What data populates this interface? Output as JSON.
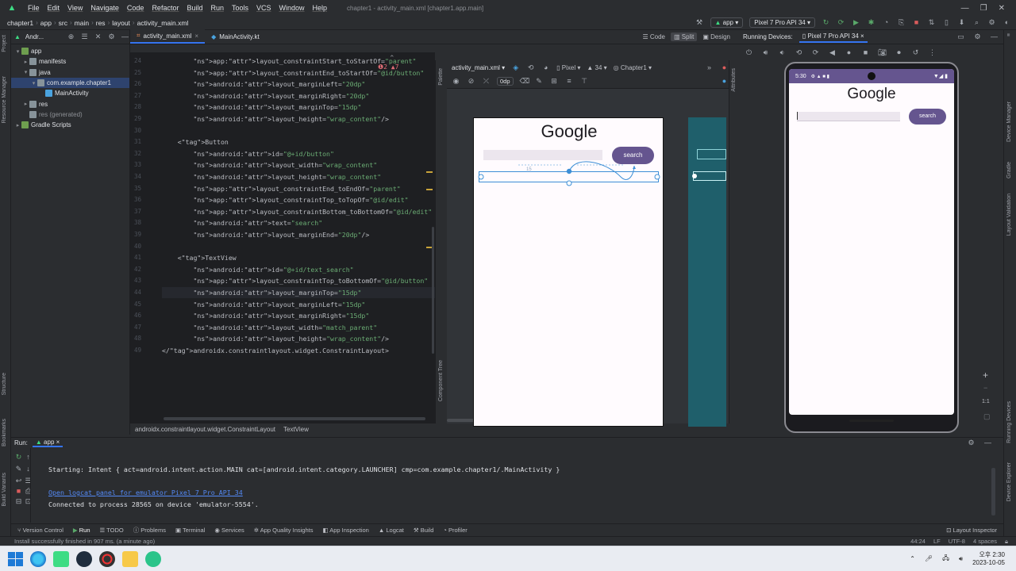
{
  "menubar": {
    "items": [
      "File",
      "Edit",
      "View",
      "Navigate",
      "Code",
      "Refactor",
      "Build",
      "Run",
      "Tools",
      "VCS",
      "Window",
      "Help"
    ],
    "title": "chapter1 - activity_main.xml [chapter1.app.main]"
  },
  "navbar": {
    "crumbs": [
      "chapter1",
      "app",
      "src",
      "main",
      "res",
      "layout",
      "activity_main.xml"
    ],
    "run_config": "app",
    "device": "Pixel 7 Pro API 34"
  },
  "project": {
    "header": "Andr...",
    "tree": [
      {
        "label": "app",
        "indent": 0,
        "arrow": "▾",
        "icon": "#6e9e4f"
      },
      {
        "label": "manifests",
        "indent": 1,
        "arrow": "▸",
        "icon": "#87939a"
      },
      {
        "label": "java",
        "indent": 1,
        "arrow": "▾",
        "icon": "#87939a"
      },
      {
        "label": "com.example.chapter1",
        "indent": 2,
        "arrow": "▾",
        "icon": "#87939a",
        "selected": true
      },
      {
        "label": "MainActivity",
        "indent": 3,
        "arrow": "",
        "icon": "#4aa3df"
      },
      {
        "label": "res",
        "indent": 1,
        "arrow": "▸",
        "icon": "#87939a"
      },
      {
        "label": "res (generated)",
        "indent": 1,
        "arrow": "",
        "icon": "#87939a",
        "dim": true
      },
      {
        "label": "Gradle Scripts",
        "indent": 0,
        "arrow": "▸",
        "icon": "#6e9e4f"
      }
    ]
  },
  "left_strip": {
    "project": "Project",
    "resource_manager": "Resource Manager",
    "structure": "Structure",
    "bookmarks": "Bookmarks",
    "build_variants": "Build Variants"
  },
  "editor": {
    "tabs": [
      {
        "label": "activity_main.xml",
        "active": true
      },
      {
        "label": "MainActivity.kt",
        "active": false
      }
    ],
    "modes": [
      "Code",
      "Split",
      "Design"
    ],
    "warnings": "❶2  ▲7",
    "lines": [
      {
        "n": "24",
        "text": "        app:layout_constraintStart_toStartOf=\"parent\""
      },
      {
        "n": "25",
        "text": "        app:layout_constraintEnd_toStartOf=\"@id/button\""
      },
      {
        "n": "26",
        "text": "        android:layout_marginLeft=\"20dp\""
      },
      {
        "n": "27",
        "text": "        android:layout_marginRight=\"20dp\""
      },
      {
        "n": "28",
        "text": "        android:layout_marginTop=\"15dp\""
      },
      {
        "n": "29",
        "text": "        android:layout_height=\"wrap_content\"/>"
      },
      {
        "n": "30",
        "text": ""
      },
      {
        "n": "31",
        "text": "    <Button"
      },
      {
        "n": "32",
        "text": "        android:id=\"@+id/button\""
      },
      {
        "n": "33",
        "text": "        android:layout_width=\"wrap_content\""
      },
      {
        "n": "34",
        "text": "        android:layout_height=\"wrap_content\""
      },
      {
        "n": "35",
        "text": "        app:layout_constraintEnd_toEndOf=\"parent\""
      },
      {
        "n": "36",
        "text": "        app:layout_constraintTop_toTopOf=\"@id/edit\""
      },
      {
        "n": "37",
        "text": "        app:layout_constraintBottom_toBottomOf=\"@id/edit\""
      },
      {
        "n": "38",
        "text": "        android:text=\"search\""
      },
      {
        "n": "39",
        "text": "        android:layout_marginEnd=\"20dp\"/>"
      },
      {
        "n": "40",
        "text": ""
      },
      {
        "n": "41",
        "text": "    <TextView"
      },
      {
        "n": "42",
        "text": "        android:id=\"@+id/text_search\""
      },
      {
        "n": "43",
        "text": "        app:layout_constraintTop_toBottomOf=\"@id/button\""
      },
      {
        "n": "44",
        "text": "        android:layout_marginTop=\"15dp\""
      },
      {
        "n": "45",
        "text": "        android:layout_marginLeft=\"15dp\""
      },
      {
        "n": "46",
        "text": "        android:layout_marginRight=\"15dp\""
      },
      {
        "n": "47",
        "text": "        android:layout_width=\"match_parent\""
      },
      {
        "n": "48",
        "text": "        android:layout_height=\"wrap_content\"/>"
      },
      {
        "n": "49",
        "text": "</androidx.constraintlayout.widget.ConstraintLayout>"
      }
    ],
    "status_crumbs": [
      "androidx.constraintlayout.widget.ConstraintLayout",
      "TextView"
    ]
  },
  "layout_editor": {
    "file": "activity_main.xml",
    "device": "Pixel",
    "api": "34",
    "theme": "Chapter1",
    "margin": "0dp",
    "palette": "Palette",
    "component_tree": "Component Tree",
    "attributes": "Attributes",
    "preview": {
      "title": "Google",
      "button": "search",
      "margin_hint": "15"
    }
  },
  "running_devices": {
    "header": "Running Devices:",
    "tab": "Pixel 7 Pro API 34",
    "status_time": "5:30",
    "app_title": "Google",
    "button": "search",
    "zoom_label": "1:1"
  },
  "right_strip": {
    "device_manager": "Device Manager",
    "gradle": "Gradle",
    "layout_validation": "Layout Validation",
    "running_devices": "Running Devices",
    "device_explorer": "Device Explorer"
  },
  "run": {
    "label": "Run:",
    "config": "app",
    "lines": [
      {
        "text": "Starting: Intent { act=android.intent.action.MAIN cat=[android.intent.category.LAUNCHER] cmp=com.example.chapter1/.MainActivity }",
        "link": false
      },
      {
        "text": "",
        "link": false
      },
      {
        "text": "Open logcat panel for emulator Pixel 7 Pro API 34",
        "link": true
      },
      {
        "text": "Connected to process 28565 on device 'emulator-5554'.",
        "link": false
      }
    ]
  },
  "bottom_tabs": [
    "Version Control",
    "Run",
    "TODO",
    "Problems",
    "Terminal",
    "Services",
    "App Quality Insights",
    "App Inspection",
    "Logcat",
    "Build",
    "Profiler"
  ],
  "layout_inspector": "Layout Inspector",
  "status": {
    "message": "Install successfully finished in 907 ms. (a minute ago)",
    "position": "44:24",
    "line_sep": "LF",
    "encoding": "UTF-8",
    "indent": "4 spaces"
  },
  "taskbar": {
    "time": "오후 2:30",
    "date": "2023-10-05"
  }
}
